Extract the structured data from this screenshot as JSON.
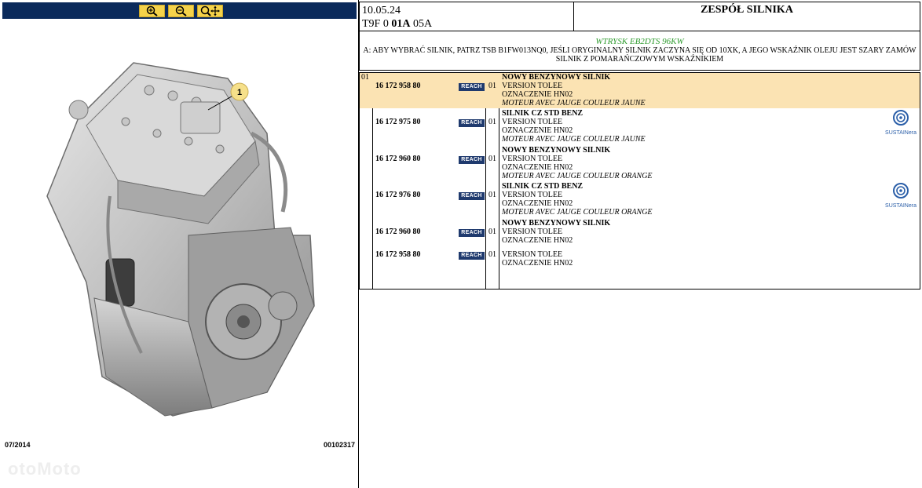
{
  "toolbar": {
    "zoom_in": "zoom-in-icon",
    "zoom_out": "zoom-out-icon",
    "zoom_pan": "zoom-pan-icon"
  },
  "illustration": {
    "callout": "1",
    "date": "07/2014",
    "ref": "00102317",
    "watermark": "otoMoto"
  },
  "header": {
    "date": "10.05.24",
    "code_prefix": "T9F 0 ",
    "code_bold": "01A",
    "code_suffix": " 05A",
    "title": "ZESPÓŁ SILNIKA"
  },
  "note": {
    "engine": "WTRYSK EB2DTS 96KW",
    "text": "A: ABY WYBRAĆ SILNIK, PATRZ TSB B1FW013NQ0, JEŚLI ORYGINALNY SILNIK ZACZYNA SIĘ OD 10XK, A JEGO WSKAŹNIK OLEJU JEST SZARY ZAMÓW SILNIK Z POMARAŃCZOWYM WSKAŹNIKIEM"
  },
  "parts": {
    "index": "01",
    "reach_label": "REACH",
    "sustain_label": "SUSTAINera",
    "rows": [
      {
        "ref": "16 172 958 80",
        "qty": "01",
        "title": "NOWY BENZYNOWY SILNIK",
        "l1": "VERSION TOLEE",
        "l2": "OZNACZENIE HN02",
        "l3": "MOTEUR AVEC JAUGE COULEUR JAUNE"
      },
      {
        "ref": "16 172 975 80",
        "qty": "01",
        "title": "SILNIK CZ STD BENZ",
        "l1": "VERSION TOLEE",
        "l2": "OZNACZENIE HN02",
        "l3": "MOTEUR AVEC JAUGE COULEUR JAUNE"
      },
      {
        "ref": "16 172 960 80",
        "qty": "01",
        "title": "NOWY BENZYNOWY SILNIK",
        "l1": "VERSION TOLEE",
        "l2": "OZNACZENIE HN02",
        "l3": "MOTEUR AVEC JAUGE COULEUR ORANGE"
      },
      {
        "ref": "16 172 976 80",
        "qty": "01",
        "title": "SILNIK CZ STD BENZ",
        "l1": "VERSION TOLEE",
        "l2": "OZNACZENIE HN02",
        "l3": "MOTEUR AVEC JAUGE COULEUR ORANGE"
      },
      {
        "ref": "16 172 960 80",
        "qty": "01",
        "title": "NOWY BENZYNOWY SILNIK",
        "l1": "VERSION TOLEE",
        "l2": "OZNACZENIE HN02"
      },
      {
        "ref": "16 172 958 80",
        "qty": "01",
        "l1": "VERSION TOLEE",
        "l2": "OZNACZENIE HN02"
      }
    ]
  },
  "colors": {
    "toolbar_bg": "#0b2a5b",
    "zoom_btn": "#f4d24a",
    "highlight_row": "#fbe3b3",
    "engine_green": "#2e9b2e",
    "reach_badge": "#1f3a6e"
  }
}
